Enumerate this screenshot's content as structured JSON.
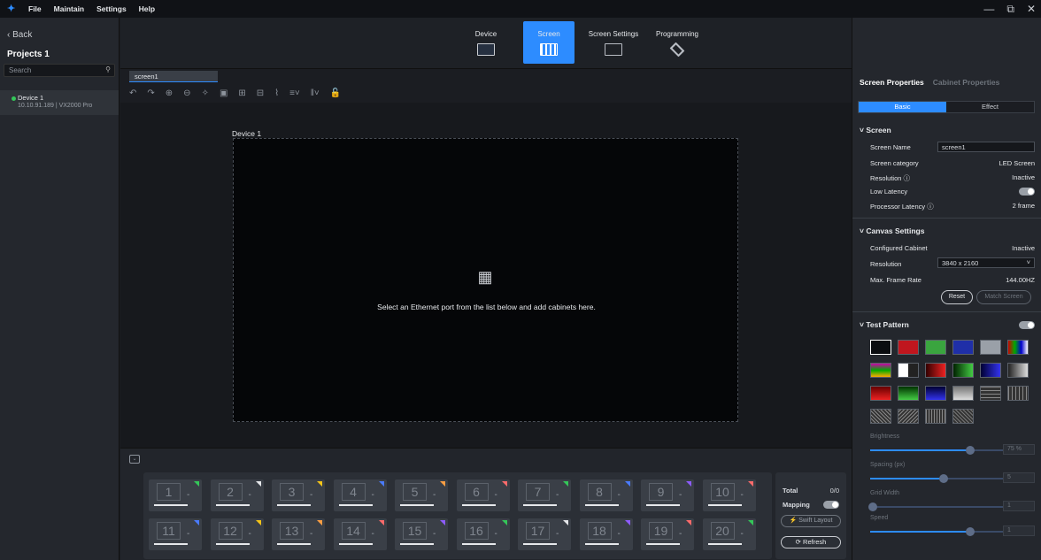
{
  "title_bar": {
    "logo": "✦",
    "menus": [
      "File",
      "Maintain",
      "Settings",
      "Help"
    ],
    "controls": [
      "—",
      "⧉",
      "✕"
    ]
  },
  "sidebar": {
    "back_label": "Back",
    "project_title": "Projects 1",
    "search_placeholder": "Search",
    "device_name": "Device 1",
    "device_info": "10.10.91.189 | VX2000 Pro"
  },
  "top_nav": {
    "items": [
      {
        "label": "Device",
        "icon": "device-icon",
        "active": false
      },
      {
        "label": "Screen",
        "icon": "screen-icon",
        "active": true
      },
      {
        "label": "Screen Settings",
        "icon": "screen-settings-icon",
        "active": false
      },
      {
        "label": "Programming",
        "icon": "layers-icon",
        "active": false
      }
    ]
  },
  "tab": {
    "label": "screen1"
  },
  "canvas": {
    "device_label": "Device 1",
    "hint": "Select an Ethernet port from the list below and add cabinets here."
  },
  "ports": {
    "row1": [
      "1",
      "2",
      "3",
      "4",
      "5",
      "6",
      "7",
      "8",
      "9",
      "10"
    ],
    "row2": [
      "11",
      "12",
      "13",
      "14",
      "15",
      "16",
      "17",
      "18",
      "19",
      "20"
    ],
    "flag_colors_row1": [
      "#34c759",
      "#e6e8eb",
      "#f5c518",
      "#4a7bff",
      "#ff9f43",
      "#ff6b6b",
      "#34c759",
      "#4a7bff",
      "#8e5cff",
      "#ff6b6b"
    ],
    "flag_colors_row2": [
      "#4a7bff",
      "#f5c518",
      "#ff9f43",
      "#ff6b6b",
      "#8e5cff",
      "#34c759",
      "#e6e8eb",
      "#8e5cff",
      "#ff6b6b",
      "#34c759"
    ]
  },
  "port_controls": {
    "total_label": "Total",
    "total_value": "0/0",
    "mapping_label": "Mapping",
    "swift_layout": "⚡ Swift Layout",
    "refresh": "⟳ Refresh"
  },
  "right_panel": {
    "tab_screen_props": "Screen Properties",
    "tab_cabinet_props": "Cabinet Properties",
    "seg_basic": "Basic",
    "seg_effect": "Effect",
    "screen_section": "Screen",
    "screen_name_label": "Screen Name",
    "screen_name_value": "screen1",
    "screen_category_label": "Screen category",
    "screen_category_value": "LED Screen",
    "resolution_label": "Resolution ⓘ",
    "resolution_value": "Inactive",
    "low_latency_label": "Low Latency",
    "processor_latency_label": "Processor Latency ⓘ",
    "processor_latency_value": "2 frame",
    "canvas_section": "Canvas Settings",
    "configured_cabinet_label": "Configured Cabinet",
    "configured_cabinet_value": "Inactive",
    "canvas_resolution_label": "Resolution",
    "canvas_resolution_value": "3840 x 2160",
    "max_frame_rate_label": "Max. Frame Rate",
    "max_frame_rate_value": "144.00HZ",
    "reset": "Reset",
    "match_screen": "Match Screen",
    "test_pattern_section": "Test Pattern",
    "brightness_label": "Brightness",
    "brightness_value": "75 %",
    "brightness_level": 0.75,
    "spacing_label": "Spacing (px)",
    "spacing_value": "5",
    "spacing_level": 0.55,
    "grid_width_label": "Grid Width",
    "grid_width_value": "1",
    "grid_width_level": 0.02,
    "speed_label": "Speed",
    "speed_value": "1",
    "speed_level": 0.75
  }
}
